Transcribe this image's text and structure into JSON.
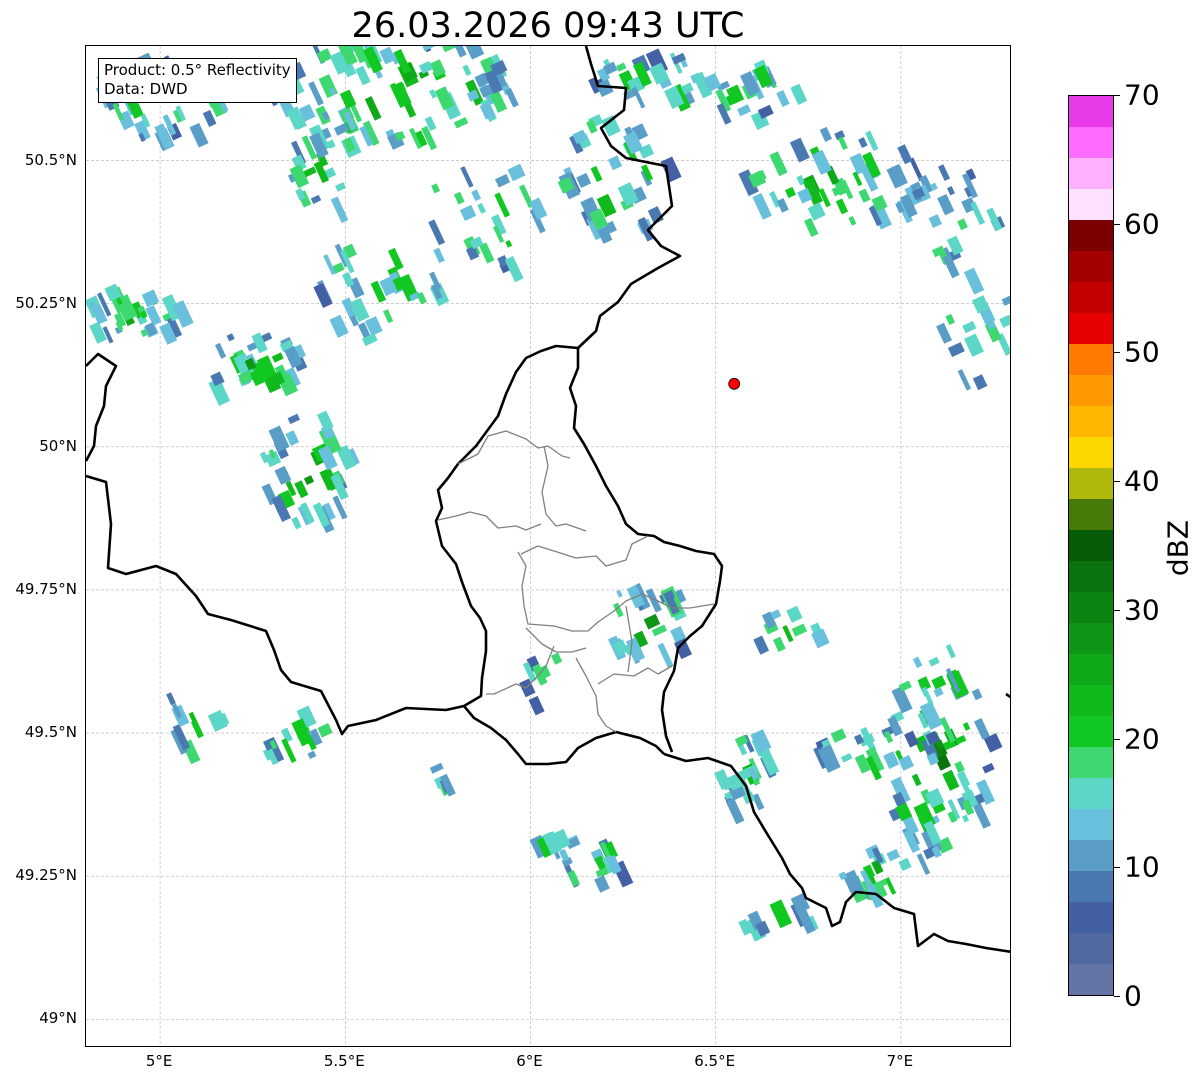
{
  "title": "26.03.2026 09:43 UTC",
  "info": {
    "product": "Product: 0.5° Reflectivity",
    "data": "Data: DWD"
  },
  "map": {
    "lon_range": [
      4.8,
      7.3
    ],
    "lat_range": [
      48.95,
      50.7
    ],
    "gridlines": true,
    "lat_ticks": [
      {
        "value": 49.0,
        "label": "49°N"
      },
      {
        "value": 49.25,
        "label": "49.25°N"
      },
      {
        "value": 49.5,
        "label": "49.5°N"
      },
      {
        "value": 49.75,
        "label": "49.75°N"
      },
      {
        "value": 50.0,
        "label": "50°N"
      },
      {
        "value": 50.25,
        "label": "50.25°N"
      },
      {
        "value": 50.5,
        "label": "50.5°N"
      }
    ],
    "lon_ticks": [
      {
        "value": 5.0,
        "label": "5°E"
      },
      {
        "value": 5.5,
        "label": "5.5°E"
      },
      {
        "value": 6.0,
        "label": "6°E"
      },
      {
        "value": 6.5,
        "label": "6.5°E"
      },
      {
        "value": 7.0,
        "label": "7°E"
      }
    ],
    "radar_site": {
      "lon": 6.55,
      "lat": 50.11
    },
    "colors": {
      "border": "#000000",
      "admin": "#808080",
      "site": "#ff0000"
    }
  },
  "colorbar": {
    "label": "dBZ",
    "min": 0,
    "max": 70,
    "tick_labels": [
      "0",
      "10",
      "20",
      "30",
      "40",
      "50",
      "60",
      "70"
    ],
    "colors": [
      "#6375a4",
      "#5168a0",
      "#4360a4",
      "#4a78b0",
      "#5a9ec8",
      "#68c0dc",
      "#5cd6c6",
      "#3ed870",
      "#11c822",
      "#10ba1c",
      "#0ea818",
      "#0e9616",
      "#0c8412",
      "#0a720e",
      "#075c08",
      "#487a0a",
      "#aeb80a",
      "#ffd700",
      "#ffb700",
      "#ff9900",
      "#ff7a00",
      "#e60000",
      "#c30000",
      "#a30000",
      "#7d0000",
      "#ffe0ff",
      "#ffb0ff",
      "#ff6bff",
      "#e83ae8"
    ]
  }
}
